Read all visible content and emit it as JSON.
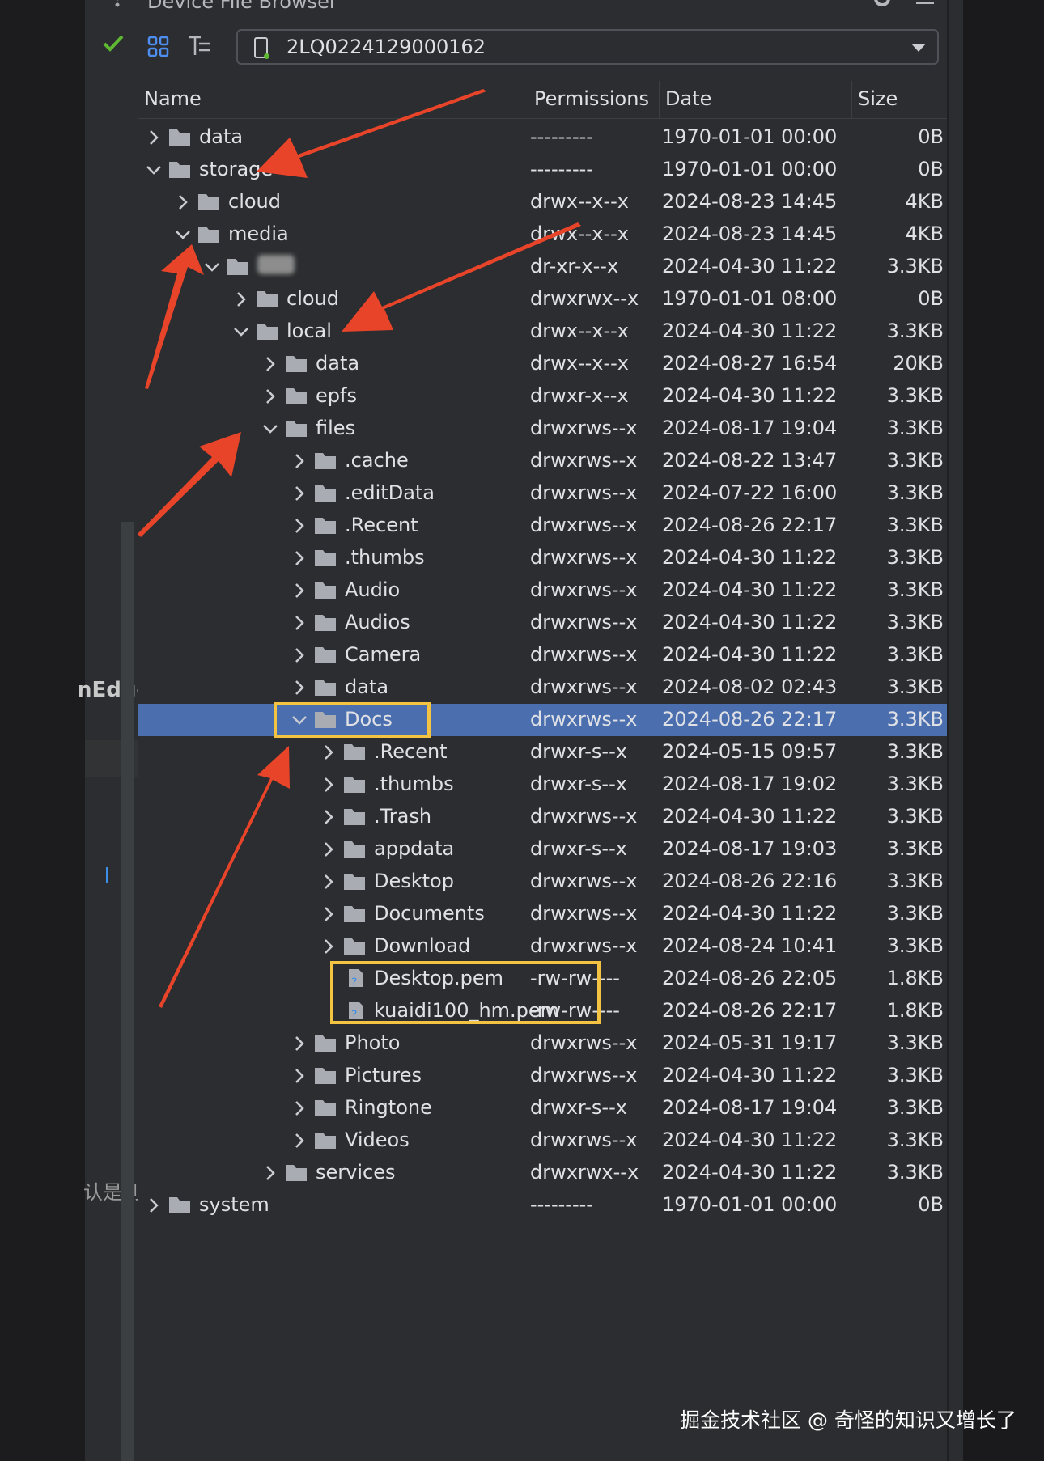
{
  "panel": {
    "title": "Device File Browser",
    "device": "2LQ0224129000162"
  },
  "columns": {
    "name": "Name",
    "permissions": "Permissions",
    "date": "Date",
    "size": "Size"
  },
  "left_fragments": {
    "edge_text": "nEdge",
    "cjk_text": "认是到"
  },
  "rows": [
    {
      "depth": 0,
      "state": "collapsed",
      "type": "folder",
      "name": "data",
      "perm": "---------",
      "date": "1970-01-01 00:00",
      "size": "0B"
    },
    {
      "depth": 0,
      "state": "expanded",
      "type": "folder",
      "name": "storage",
      "perm": "---------",
      "date": "1970-01-01 00:00",
      "size": "0B"
    },
    {
      "depth": 1,
      "state": "collapsed",
      "type": "folder",
      "name": "cloud",
      "perm": "drwx--x--x",
      "date": "2024-08-23 14:45",
      "size": "4KB"
    },
    {
      "depth": 1,
      "state": "expanded",
      "type": "folder",
      "name": "media",
      "perm": "drwx--x--x",
      "date": "2024-08-23 14:45",
      "size": "4KB"
    },
    {
      "depth": 2,
      "state": "expanded",
      "type": "folder",
      "name": "",
      "blur": true,
      "perm": "dr-xr-x--x",
      "date": "2024-04-30 11:22",
      "size": "3.3KB"
    },
    {
      "depth": 3,
      "state": "collapsed",
      "type": "folder",
      "name": "cloud",
      "perm": "drwxrwx--x",
      "date": "1970-01-01 08:00",
      "size": "0B"
    },
    {
      "depth": 3,
      "state": "expanded",
      "type": "folder",
      "name": "local",
      "perm": "drwx--x--x",
      "date": "2024-04-30 11:22",
      "size": "3.3KB"
    },
    {
      "depth": 4,
      "state": "collapsed",
      "type": "folder",
      "name": "data",
      "perm": "drwx--x--x",
      "date": "2024-08-27 16:54",
      "size": "20KB"
    },
    {
      "depth": 4,
      "state": "collapsed",
      "type": "folder",
      "name": "epfs",
      "perm": "drwxr-x--x",
      "date": "2024-04-30 11:22",
      "size": "3.3KB"
    },
    {
      "depth": 4,
      "state": "expanded",
      "type": "folder",
      "name": "files",
      "perm": "drwxrws--x",
      "date": "2024-08-17 19:04",
      "size": "3.3KB"
    },
    {
      "depth": 5,
      "state": "collapsed",
      "type": "folder",
      "name": ".cache",
      "perm": "drwxrws--x",
      "date": "2024-08-22 13:47",
      "size": "3.3KB"
    },
    {
      "depth": 5,
      "state": "collapsed",
      "type": "folder",
      "name": ".editData",
      "perm": "drwxrws--x",
      "date": "2024-07-22 16:00",
      "size": "3.3KB"
    },
    {
      "depth": 5,
      "state": "collapsed",
      "type": "folder",
      "name": ".Recent",
      "perm": "drwxrws--x",
      "date": "2024-08-26 22:17",
      "size": "3.3KB"
    },
    {
      "depth": 5,
      "state": "collapsed",
      "type": "folder",
      "name": ".thumbs",
      "perm": "drwxrws--x",
      "date": "2024-04-30 11:22",
      "size": "3.3KB"
    },
    {
      "depth": 5,
      "state": "collapsed",
      "type": "folder",
      "name": "Audio",
      "perm": "drwxrws--x",
      "date": "2024-04-30 11:22",
      "size": "3.3KB"
    },
    {
      "depth": 5,
      "state": "collapsed",
      "type": "folder",
      "name": "Audios",
      "perm": "drwxrws--x",
      "date": "2024-04-30 11:22",
      "size": "3.3KB"
    },
    {
      "depth": 5,
      "state": "collapsed",
      "type": "folder",
      "name": "Camera",
      "perm": "drwxrws--x",
      "date": "2024-04-30 11:22",
      "size": "3.3KB"
    },
    {
      "depth": 5,
      "state": "collapsed",
      "type": "folder",
      "name": "data",
      "perm": "drwxrws--x",
      "date": "2024-08-02 02:43",
      "size": "3.3KB"
    },
    {
      "depth": 5,
      "state": "expanded",
      "type": "folder",
      "name": "Docs",
      "selected": true,
      "perm": "drwxrws--x",
      "date": "2024-08-26 22:17",
      "size": "3.3KB"
    },
    {
      "depth": 6,
      "state": "collapsed",
      "type": "folder",
      "name": ".Recent",
      "perm": "drwxr-s--x",
      "date": "2024-05-15 09:57",
      "size": "3.3KB"
    },
    {
      "depth": 6,
      "state": "collapsed",
      "type": "folder",
      "name": ".thumbs",
      "perm": "drwxr-s--x",
      "date": "2024-08-17 19:02",
      "size": "3.3KB"
    },
    {
      "depth": 6,
      "state": "collapsed",
      "type": "folder",
      "name": ".Trash",
      "perm": "drwxrws--x",
      "date": "2024-04-30 11:22",
      "size": "3.3KB"
    },
    {
      "depth": 6,
      "state": "collapsed",
      "type": "folder",
      "name": "appdata",
      "perm": "drwxr-s--x",
      "date": "2024-08-17 19:03",
      "size": "3.3KB"
    },
    {
      "depth": 6,
      "state": "collapsed",
      "type": "folder",
      "name": "Desktop",
      "perm": "drwxrws--x",
      "date": "2024-08-26 22:16",
      "size": "3.3KB"
    },
    {
      "depth": 6,
      "state": "collapsed",
      "type": "folder",
      "name": "Documents",
      "perm": "drwxrws--x",
      "date": "2024-04-30 11:22",
      "size": "3.3KB"
    },
    {
      "depth": 6,
      "state": "collapsed",
      "type": "folder",
      "name": "Download",
      "perm": "drwxrws--x",
      "date": "2024-08-24 10:41",
      "size": "3.3KB"
    },
    {
      "depth": 6,
      "state": "leaf",
      "type": "file",
      "name": "Desktop.pem",
      "perm": "-rw-rw----",
      "date": "2024-08-26 22:05",
      "size": "1.8KB"
    },
    {
      "depth": 6,
      "state": "leaf",
      "type": "file",
      "name": "kuaidi100_hm.pem",
      "perm": "-rw-rw----",
      "date": "2024-08-26 22:17",
      "size": "1.8KB"
    },
    {
      "depth": 5,
      "state": "collapsed",
      "type": "folder",
      "name": "Photo",
      "perm": "drwxrws--x",
      "date": "2024-05-31 19:17",
      "size": "3.3KB"
    },
    {
      "depth": 5,
      "state": "collapsed",
      "type": "folder",
      "name": "Pictures",
      "perm": "drwxrws--x",
      "date": "2024-04-30 11:22",
      "size": "3.3KB"
    },
    {
      "depth": 5,
      "state": "collapsed",
      "type": "folder",
      "name": "Ringtone",
      "perm": "drwxr-s--x",
      "date": "2024-08-17 19:04",
      "size": "3.3KB"
    },
    {
      "depth": 5,
      "state": "collapsed",
      "type": "folder",
      "name": "Videos",
      "perm": "drwxrws--x",
      "date": "2024-04-30 11:22",
      "size": "3.3KB"
    },
    {
      "depth": 4,
      "state": "collapsed",
      "type": "folder",
      "name": "services",
      "perm": "drwxrwx--x",
      "date": "2024-04-30 11:22",
      "size": "3.3KB"
    },
    {
      "depth": 0,
      "state": "collapsed",
      "type": "folder",
      "name": "system",
      "perm": "---------",
      "date": "1970-01-01 00:00",
      "size": "0B"
    }
  ],
  "watermark": "掘金技术社区 @ 奇怪的知识又增长了",
  "colors": {
    "annotation_arrow": "#e8442a",
    "highlight_box": "#f5c342",
    "selection": "#4b6eaf",
    "panel_bg": "#2b2d30",
    "folder_icon": "#a9adb3"
  }
}
